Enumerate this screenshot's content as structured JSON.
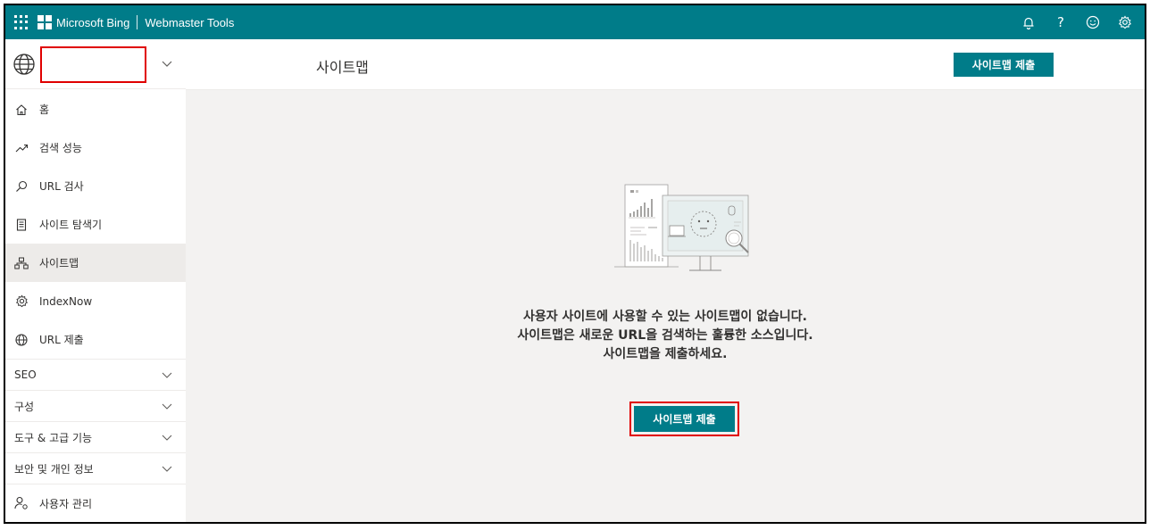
{
  "topbar": {
    "brand": "Microsoft Bing",
    "product": "Webmaster Tools",
    "icons": [
      "bell-icon",
      "help-icon",
      "smiley-icon",
      "gear-icon"
    ],
    "help_glyph": "?",
    "accent": "#007c89"
  },
  "site_picker": {
    "icon": "globe-icon",
    "value": "",
    "dropdown_icon": "chevron-down-icon"
  },
  "sidebar": {
    "items": [
      {
        "label": "홈",
        "icon": "home-icon"
      },
      {
        "label": "검색 성능",
        "icon": "trend-up-icon"
      },
      {
        "label": "URL 검사",
        "icon": "search-icon"
      },
      {
        "label": "사이트 탐색기",
        "icon": "document-icon"
      },
      {
        "label": "사이트맵",
        "icon": "sitemap-icon",
        "active": true
      },
      {
        "label": "IndexNow",
        "icon": "gear-icon"
      },
      {
        "label": "URL 제출",
        "icon": "globe-icon"
      }
    ],
    "groups": [
      {
        "label": "SEO"
      },
      {
        "label": "구성"
      },
      {
        "label": "도구 & 고급 기능"
      },
      {
        "label": "보안 및 개인 정보"
      }
    ],
    "footer_item": {
      "label": "사용자 관리",
      "icon": "user-settings-icon"
    }
  },
  "main": {
    "title": "사이트맵",
    "header_button": "사이트맵 제출",
    "empty_state": {
      "line1": "사용자 사이트에 사용할 수 있는 사이트맵이 없습니다.",
      "line2": "사이트맵은 새로운 URL을 검색하는 훌륭한 소스입니다.",
      "line3": "사이트맵을 제출하세요.",
      "button": "사이트맵 제출"
    }
  },
  "colors": {
    "highlight": "#e00000",
    "active_nav": "#edebe9",
    "content_bg": "#f3f2f1"
  }
}
